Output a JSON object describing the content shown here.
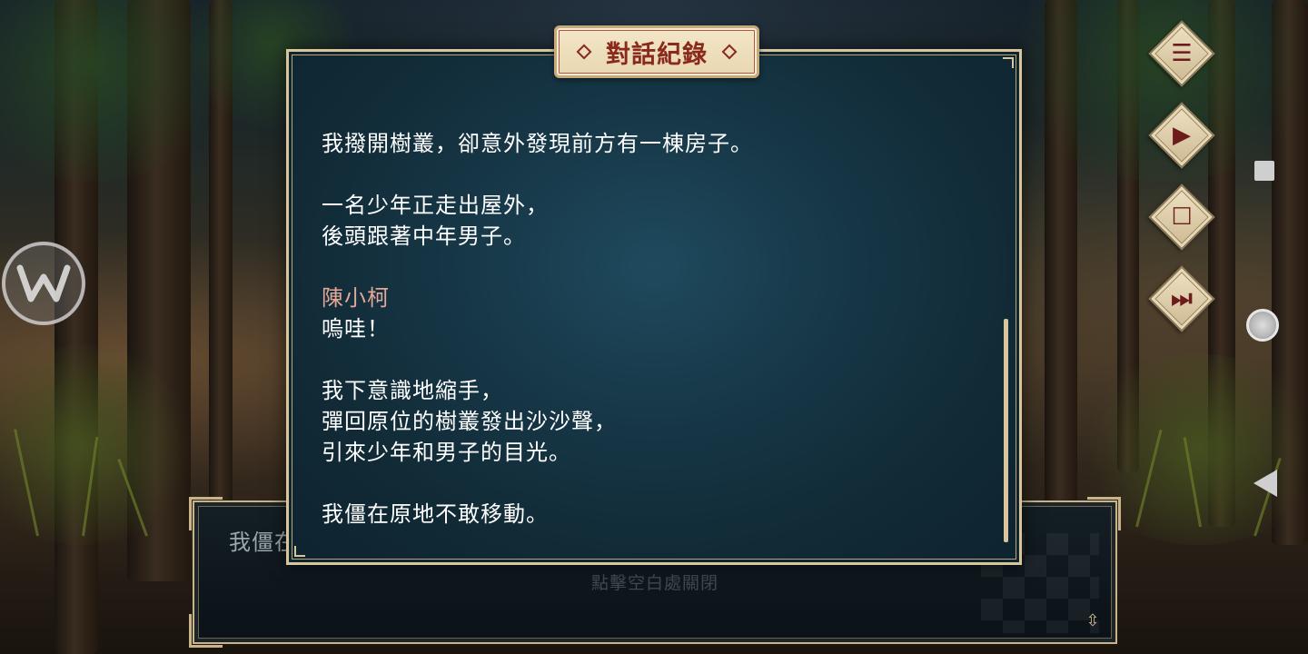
{
  "log": {
    "title": "對話紀錄",
    "entries": [
      {
        "speaker": "",
        "lines": [
          "我撥開樹叢，卻意外發現前方有一棟房子。"
        ]
      },
      {
        "speaker": "",
        "lines": [
          "一名少年正走出屋外，",
          "後頭跟著中年男子。"
        ]
      },
      {
        "speaker": "陳小柯",
        "lines": [
          "嗚哇！"
        ]
      },
      {
        "speaker": "",
        "lines": [
          "我下意識地縮手，",
          "彈回原位的樹叢發出沙沙聲，",
          "引來少年和男子的目光。"
        ]
      },
      {
        "speaker": "",
        "lines": [
          "我僵在原地不敢移動。"
        ]
      }
    ],
    "scroll_position": 1.0
  },
  "textbox": {
    "text": "我僵在",
    "close_hint": "點擊空白處關閉"
  },
  "side_menu": [
    {
      "name": "menu",
      "icon": "menu-icon",
      "glyph": "☰"
    },
    {
      "name": "auto-play",
      "icon": "play-icon",
      "glyph": "▶"
    },
    {
      "name": "stop",
      "icon": "square-icon",
      "glyph": "☐"
    },
    {
      "name": "skip",
      "icon": "fast-forward-icon",
      "glyph": "⏭"
    }
  ],
  "colors": {
    "speaker": "#e3a698",
    "title_text": "#8a2a1c",
    "frame": "#d8c59c",
    "panel_bg": "#173848"
  }
}
